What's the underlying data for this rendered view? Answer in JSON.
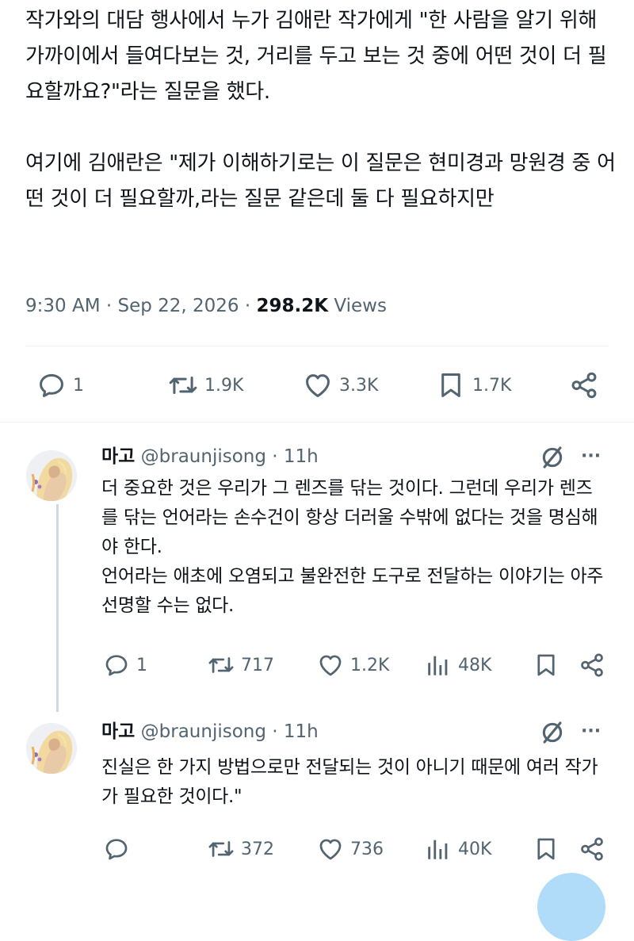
{
  "tweet": {
    "paragraphs": [
      "작가와의 대담 행사에서 누가 김애란 작가에게 \"한 사람을 알기 위해 가까이에서 들여다보는 것, 거리를 두고 보는 것 중에 어떤 것이 더 필요할까요?\"라는 질문을 했다.",
      "여기에 김애란은 \"제가 이해하기로는 이 질문은 현미경과 망원경 중 어떤 것이 더 필요할까,라는 질문 같은데 둘 다 필요하지만"
    ],
    "time": "9:30 AM",
    "date": "Sep 22, 2026",
    "sep": "·",
    "views_count": "298.2K",
    "views_label": "Views",
    "actions": {
      "replies": "1",
      "retweets": "1.9K",
      "likes": "3.3K",
      "bookmarks": "1.7K"
    }
  },
  "replies": [
    {
      "name": "마고",
      "handle": "@braunjisong",
      "time": "· 11h",
      "more": "···",
      "body": [
        "더 중요한 것은 우리가 그 렌즈를 닦는 것이다. 그런데 우리가 렌즈를 닦는 언어라는 손수건이 항상 더러울 수밖에 없다는 것을 명심해야 한다.",
        "언어라는 애초에 오염되고 불완전한 도구로 전달하는 이야기는 아주 선명할 수는 없다."
      ],
      "actions": {
        "replies": "1",
        "retweets": "717",
        "likes": "1.2K",
        "views": "48K"
      }
    },
    {
      "name": "마고",
      "handle": "@braunjisong",
      "time": "· 11h",
      "more": "···",
      "body": [
        "진실은 한 가지 방법으로만 전달되는 것이 아니기 때문에 여러 작가가 필요한 것이다.\""
      ],
      "actions": {
        "replies": "",
        "retweets": "372",
        "likes": "736",
        "views": "40K"
      }
    }
  ],
  "icons": {
    "reply": "speech-bubble-icon",
    "retweet": "retweet-icon",
    "like": "heart-icon",
    "bookmark": "bookmark-icon",
    "share": "share-icon",
    "views": "bar-chart-icon",
    "mute": "slashed-circle-icon"
  },
  "colors": {
    "text": "#0f1419",
    "secondary": "#536471",
    "divider": "#eff3f4",
    "thread_line": "#cfd9de",
    "accent": "#1d9bf0"
  }
}
